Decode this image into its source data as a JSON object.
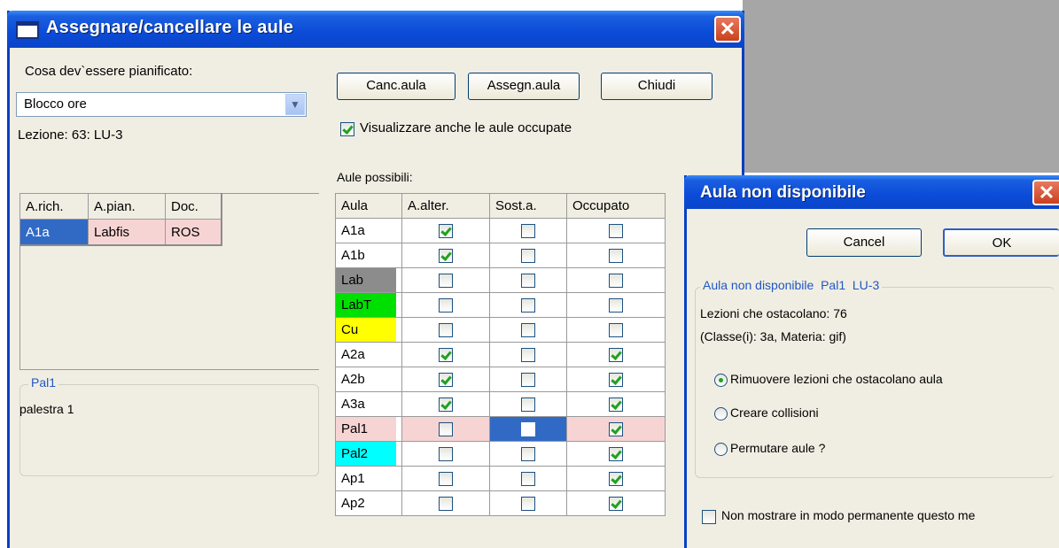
{
  "main_window": {
    "title": "Assegnare/cancellare le aule",
    "plan_label": "Cosa dev`essere pianificato:",
    "plan_value": "Blocco ore",
    "lesson_label": "Lezione: 63: LU-3",
    "buttons": {
      "cancel_room": "Canc.aula",
      "assign_room": "Assegn.aula",
      "close": "Chiudi"
    },
    "show_occupied_label": "Visualizzare anche le aule occupate",
    "show_occupied_checked": true,
    "possible_rooms_label": "Aule possibili:",
    "assign_table": {
      "headers": [
        "A.rich.",
        "A.pian.",
        "Doc."
      ],
      "row": [
        "A1a",
        "Labfis",
        "ROS"
      ]
    },
    "room_box": {
      "title": "Pal1",
      "text": "palestra 1"
    },
    "rooms_table": {
      "headers": [
        "Aula",
        "A.alter.",
        "Sost.a.",
        "Occupato"
      ],
      "rows": [
        {
          "name": "A1a",
          "color": "",
          "alter": true,
          "sost": false,
          "occ": false
        },
        {
          "name": "A1b",
          "color": "",
          "alter": true,
          "sost": false,
          "occ": false
        },
        {
          "name": "Lab",
          "color": "#8c8c8c",
          "alter": false,
          "sost": false,
          "occ": false
        },
        {
          "name": "LabT",
          "color": "#00e000",
          "alter": false,
          "sost": false,
          "occ": false
        },
        {
          "name": "Cu",
          "color": "#ffff00",
          "alter": false,
          "sost": false,
          "occ": false
        },
        {
          "name": "A2a",
          "color": "",
          "alter": true,
          "sost": false,
          "occ": true
        },
        {
          "name": "A2b",
          "color": "",
          "alter": true,
          "sost": false,
          "occ": true
        },
        {
          "name": "A3a",
          "color": "",
          "alter": true,
          "sost": false,
          "occ": true
        },
        {
          "name": "Pal1",
          "color": "#f7d4d4",
          "alter": false,
          "sost": false,
          "occ": true,
          "highlight": true
        },
        {
          "name": "Pal2",
          "color": "#00ffff",
          "alter": false,
          "sost": false,
          "occ": true
        },
        {
          "name": "Ap1",
          "color": "",
          "alter": false,
          "sost": false,
          "occ": true
        },
        {
          "name": "Ap2",
          "color": "",
          "alter": false,
          "sost": false,
          "occ": true
        }
      ]
    }
  },
  "dialog": {
    "title": "Aula non disponibile",
    "cancel": "Cancel",
    "ok": "OK",
    "group_title": "Aula non disponibile  Pal1  LU-3",
    "line1": "Lezioni che ostacolano: 76",
    "line2": "(Classe(i): 3a, Materia: gif)",
    "options": [
      "Rimuovere lezioni che ostacolano aula",
      "Creare collisioni",
      "Permutare aule ?"
    ],
    "selected_option": 0,
    "dont_show": "Non mostrare in modo permanente questo me"
  },
  "colors": {
    "title_blue": "#0b4bd8",
    "window_bg": "#f0eee3",
    "selection_blue": "#316ac5",
    "pink_row": "#f7d4d4"
  },
  "icons": [
    "window-icon",
    "close-icon",
    "dropdown-arrow-icon"
  ]
}
